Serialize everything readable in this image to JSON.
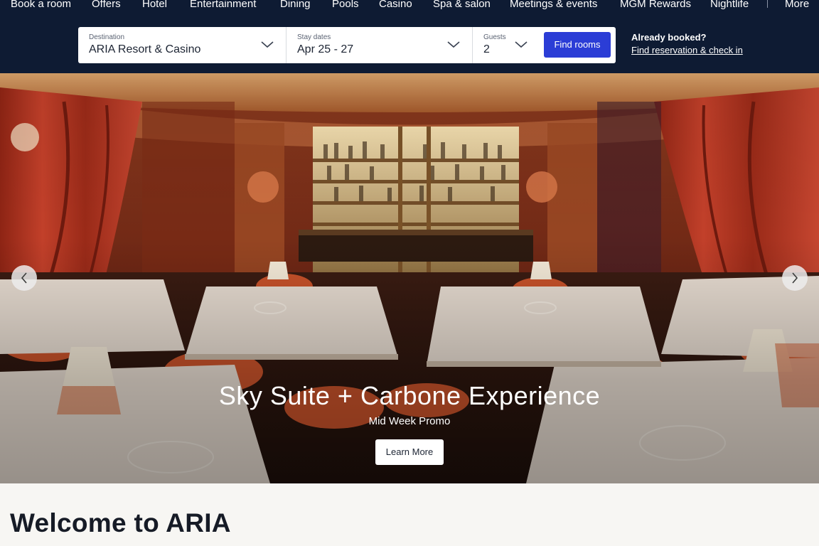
{
  "nav": {
    "items": [
      "Book a room",
      "Offers",
      "Hotel",
      "Entertainment",
      "Dining",
      "Pools",
      "Casino",
      "Spa & salon",
      "Meetings & events",
      "MGM Rewards",
      "Nightlife"
    ],
    "more": "More"
  },
  "booking": {
    "destination": {
      "label": "Destination",
      "value": "ARIA Resort & Casino"
    },
    "dates": {
      "label": "Stay dates",
      "value": "Apr 25 - 27"
    },
    "guests": {
      "label": "Guests",
      "value": "2"
    },
    "find_label": "Find rooms"
  },
  "account": {
    "already_booked": "Already booked?",
    "find_reservation": "Find reservation & check in"
  },
  "hero": {
    "title": "Sky Suite + Carbone Experience",
    "subtitle": "Mid Week Promo",
    "cta": "Learn More",
    "prev_icon": "chevron-left-icon",
    "next_icon": "chevron-right-icon"
  },
  "welcome": {
    "title": "Welcome to ARIA"
  },
  "colors": {
    "header_bg": "#0e1b33",
    "accent_button": "#2b3dd6",
    "page_bg": "#f7f6f3"
  }
}
